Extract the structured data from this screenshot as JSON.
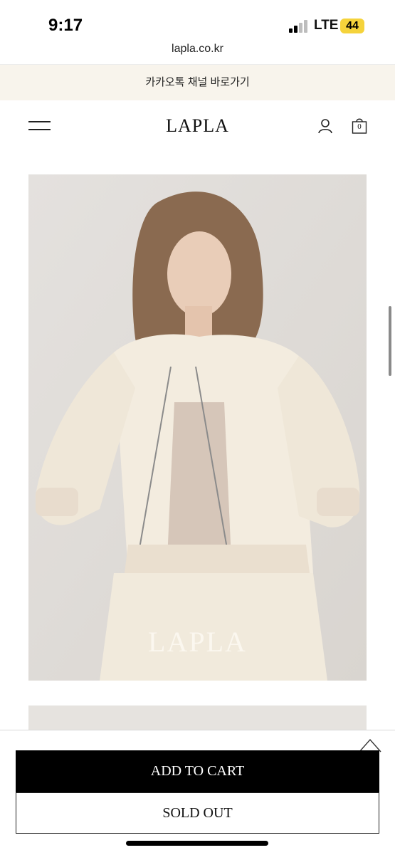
{
  "status_bar": {
    "time": "9:17",
    "network": "LTE",
    "battery": "44"
  },
  "browser": {
    "url": "lapla.co.kr"
  },
  "banner": {
    "text": "카카오톡 채널 바로가기"
  },
  "header": {
    "logo": "LAPLA",
    "cart_count": "0"
  },
  "product": {
    "image_watermark": "LAPLA"
  },
  "actions": {
    "add_to_cart": "ADD TO CART",
    "sold_out": "SOLD OUT"
  },
  "icons": [
    "menu-icon",
    "user-icon",
    "cart-icon",
    "scroll-top-icon"
  ],
  "colors": {
    "banner_bg": "#f8f4ec",
    "primary_button": "#000000",
    "battery": "#f5d33b"
  }
}
